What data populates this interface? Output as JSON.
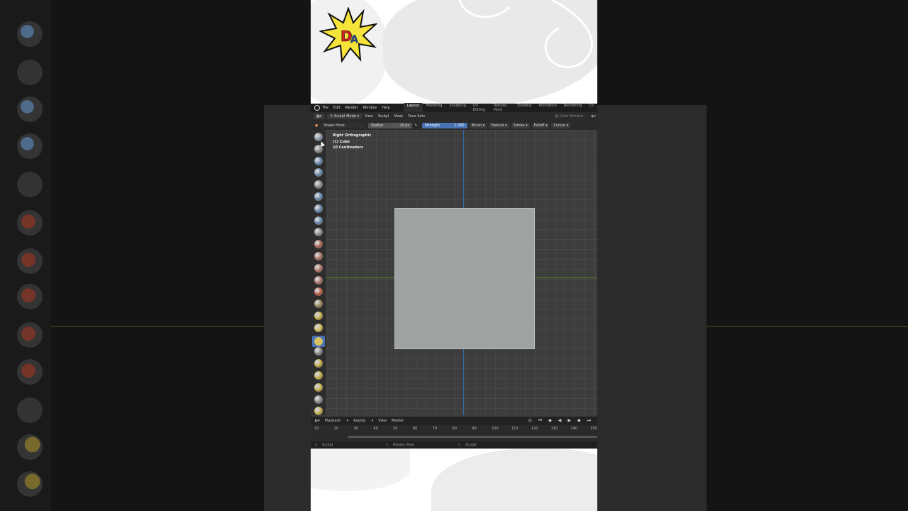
{
  "menu": [
    "File",
    "Edit",
    "Render",
    "Window",
    "Help"
  ],
  "workspaces": [
    "Layout",
    "Modeling",
    "Sculpting",
    "UV Editing",
    "Texture Paint",
    "Shading",
    "Animation",
    "Rendering",
    "Co"
  ],
  "active_workspace": "Layout",
  "header2": {
    "mode": "Sculpt Mode",
    "items": [
      "View",
      "Sculpt",
      "Mask",
      "Face Sets"
    ],
    "color_attribute": "Color Attribut..."
  },
  "tool_settings": {
    "brush_name": "Snake Hook",
    "radius_label": "Radius",
    "radius_value": "20 px",
    "strength_label": "Strength",
    "strength_value": "1.000",
    "dropdowns": [
      "Brush",
      "Texture",
      "Stroke",
      "Falloff",
      "Cursor"
    ]
  },
  "viewport": {
    "view_name": "Right Orthographic",
    "object": "(1) Cube",
    "scale": "10 Centimeters"
  },
  "timeline": {
    "menus": [
      "Playback",
      "Keying",
      "View",
      "Marker"
    ],
    "ruler": [
      "10",
      "20",
      "30",
      "40",
      "50",
      "60",
      "70",
      "80",
      "90",
      "100",
      "110",
      "120",
      "130",
      "140",
      "150"
    ]
  },
  "status": {
    "left": "Sculpt",
    "middle": "Rotate View",
    "right": "Sculpt"
  },
  "colors": {
    "accent": "#4772b3",
    "axis_z": "#2f6fb8",
    "axis_y": "#5f8a2a",
    "cube": "#9fa4a2"
  }
}
